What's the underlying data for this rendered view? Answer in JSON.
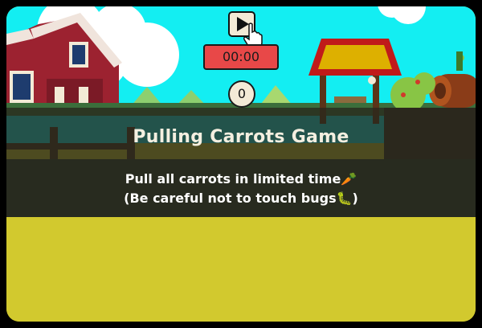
{
  "hud": {
    "play_icon": "play-icon",
    "timer": "00:00",
    "score": "0"
  },
  "popup": {
    "title": "Pulling Carrots Game",
    "line1": "Pull all carrots in limited time🥕",
    "line2": "(Be careful not to touch bugs🐛)"
  },
  "colors": {
    "sky": "#13eef2",
    "ground": "#d2c92e",
    "timer_bg": "#e84848",
    "button_bg": "#f3ead6"
  }
}
